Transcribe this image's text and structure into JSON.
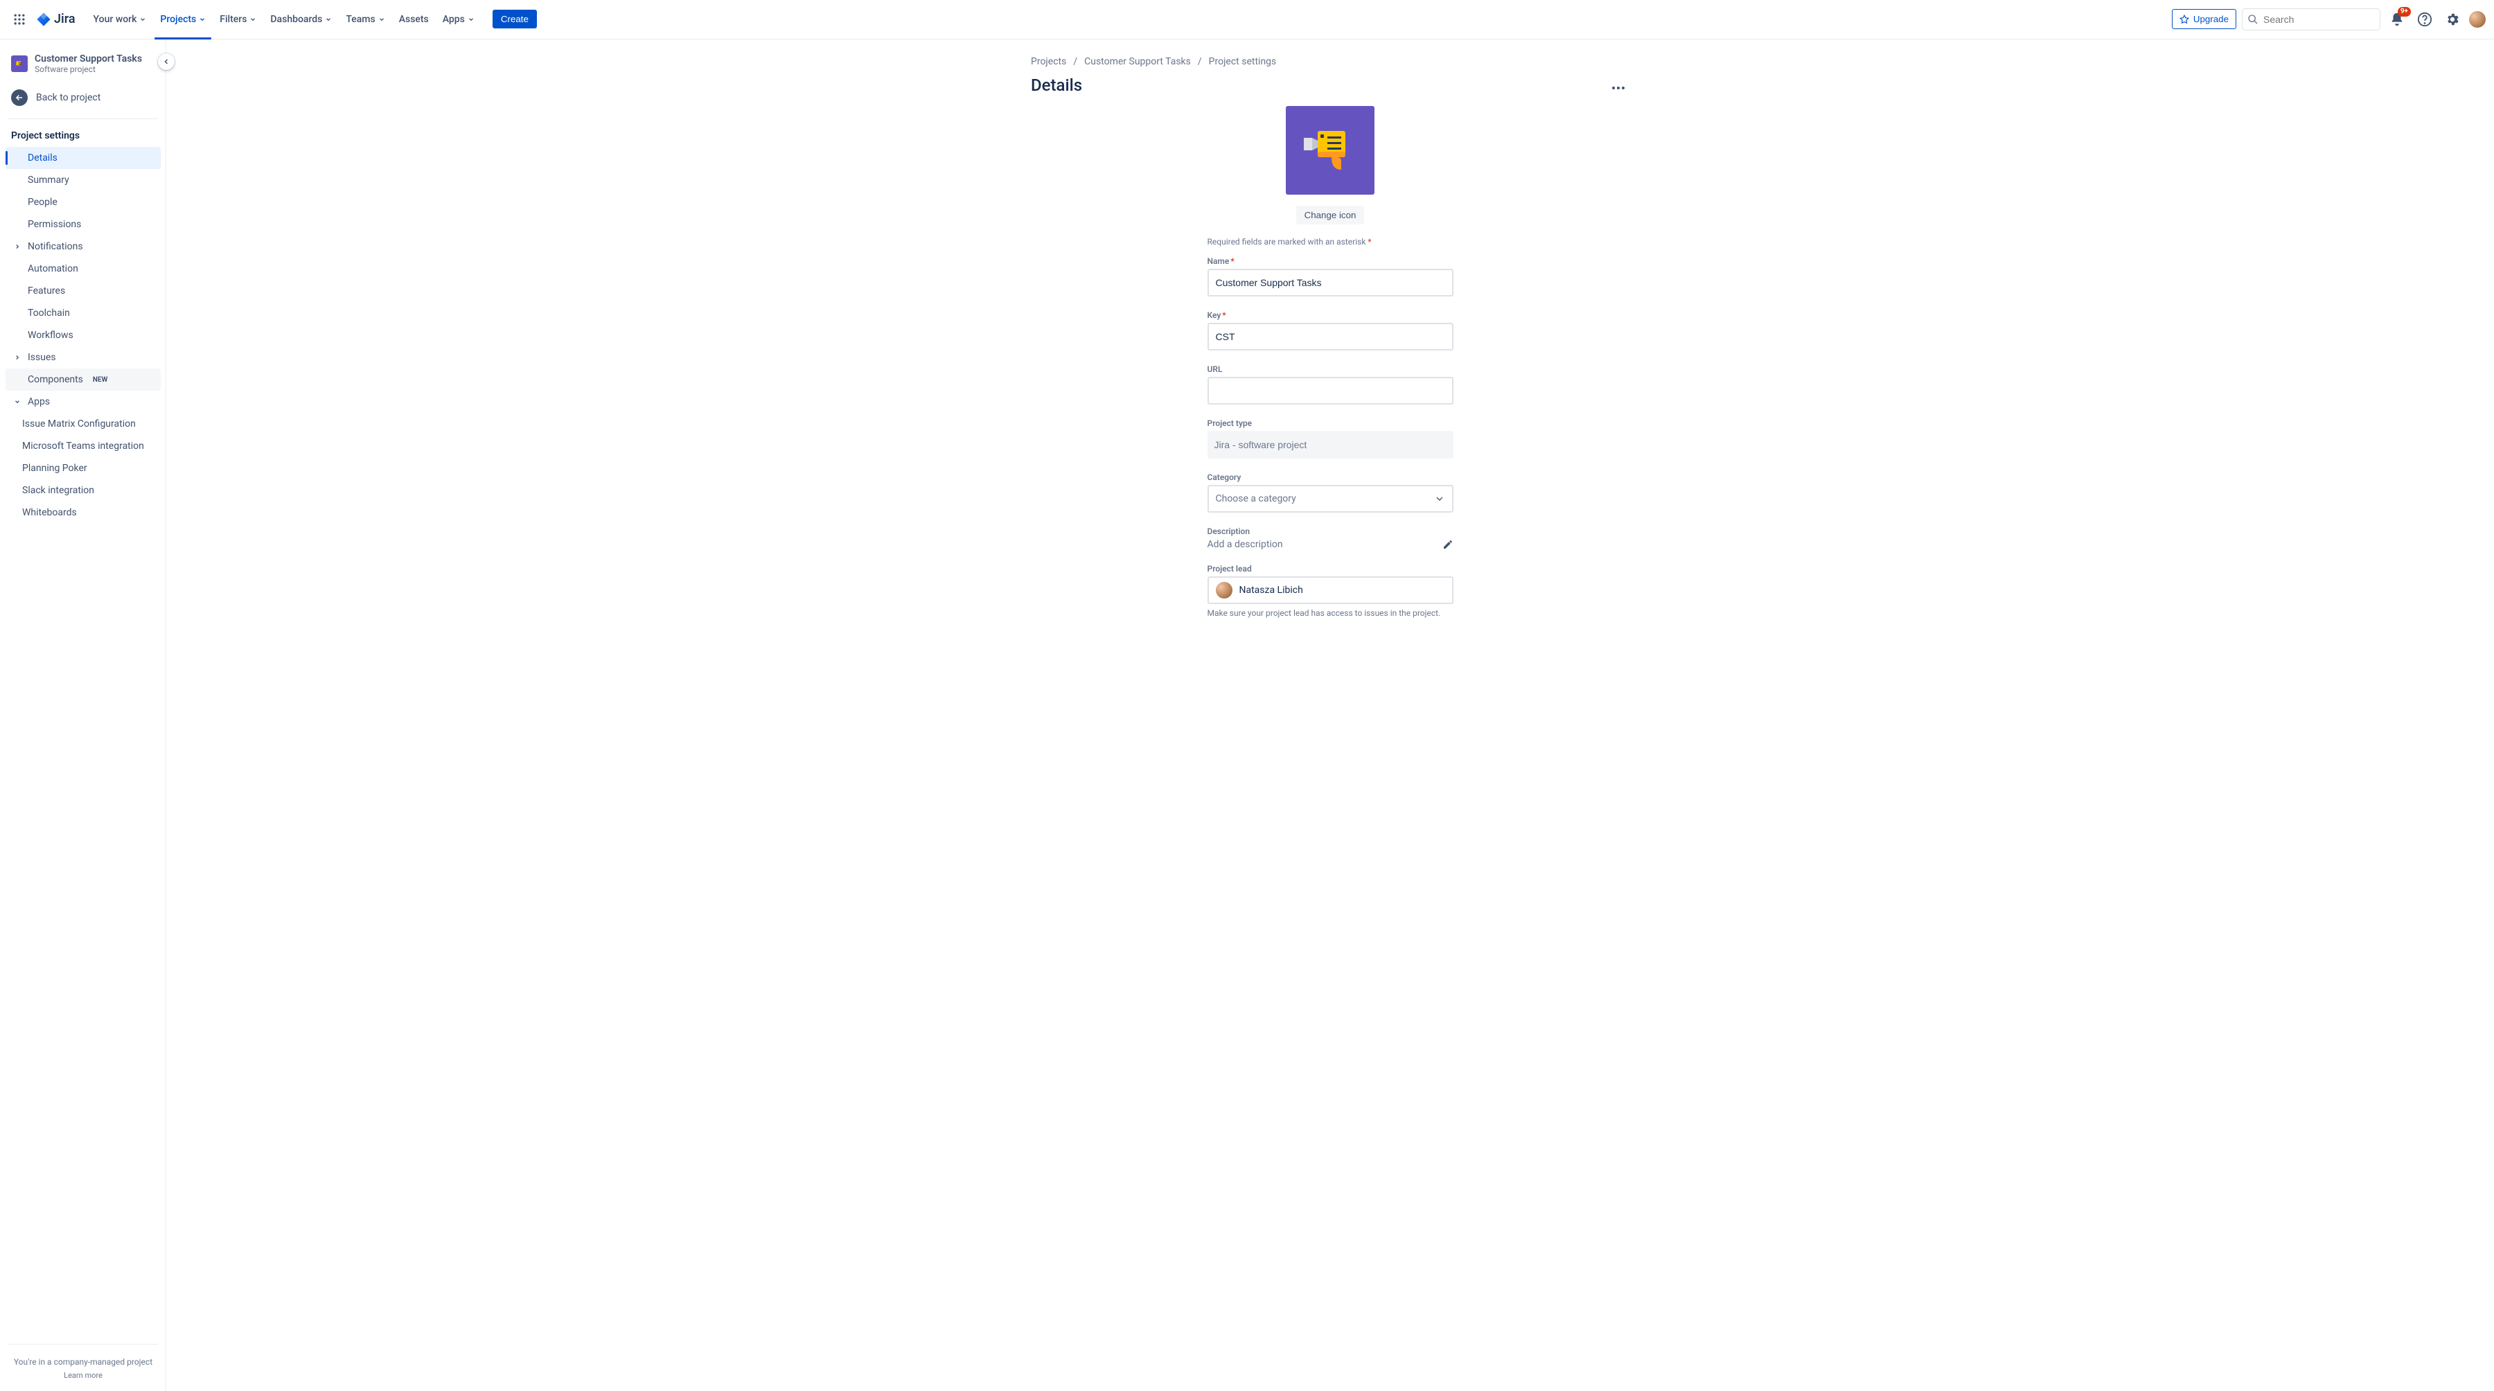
{
  "nav": {
    "logo_text": "Jira",
    "items": [
      {
        "label": "Your work",
        "hasChevron": true
      },
      {
        "label": "Projects",
        "hasChevron": true,
        "active": true
      },
      {
        "label": "Filters",
        "hasChevron": true
      },
      {
        "label": "Dashboards",
        "hasChevron": true
      },
      {
        "label": "Teams",
        "hasChevron": true
      },
      {
        "label": "Assets",
        "hasChevron": false
      },
      {
        "label": "Apps",
        "hasChevron": true
      }
    ],
    "create_label": "Create",
    "upgrade_label": "Upgrade",
    "search_placeholder": "Search",
    "notification_badge": "9+"
  },
  "sidebar": {
    "project_name": "Customer Support Tasks",
    "project_type": "Software project",
    "back_label": "Back to project",
    "heading": "Project settings",
    "items": [
      {
        "label": "Details",
        "selected": true
      },
      {
        "label": "Summary"
      },
      {
        "label": "People"
      },
      {
        "label": "Permissions"
      },
      {
        "label": "Notifications",
        "expandable": true
      },
      {
        "label": "Automation"
      },
      {
        "label": "Features"
      },
      {
        "label": "Toolchain"
      },
      {
        "label": "Workflows"
      },
      {
        "label": "Issues",
        "expandable": true
      },
      {
        "label": "Components",
        "badge": "NEW",
        "hoverBg": true
      },
      {
        "label": "Apps",
        "expandable": true,
        "expanded": true
      }
    ],
    "app_subitems": [
      {
        "label": "Issue Matrix Configuration"
      },
      {
        "label": "Microsoft Teams integration"
      },
      {
        "label": "Planning Poker"
      },
      {
        "label": "Slack integration"
      },
      {
        "label": "Whiteboards"
      }
    ],
    "footer_text": "You're in a company-managed project",
    "footer_link": "Learn more"
  },
  "breadcrumbs": [
    "Projects",
    "Customer Support Tasks",
    "Project settings"
  ],
  "page": {
    "title": "Details",
    "change_icon_label": "Change icon",
    "required_note": "Required fields are marked with an asterisk",
    "fields": {
      "name_label": "Name",
      "name_value": "Customer Support Tasks",
      "key_label": "Key",
      "key_value": "CST",
      "url_label": "URL",
      "url_value": "",
      "type_label": "Project type",
      "type_value": "Jira - software project",
      "category_label": "Category",
      "category_placeholder": "Choose a category",
      "description_label": "Description",
      "description_placeholder": "Add a description",
      "lead_label": "Project lead",
      "lead_value": "Natasza Libich",
      "lead_help": "Make sure your project lead has access to issues in the project."
    }
  }
}
